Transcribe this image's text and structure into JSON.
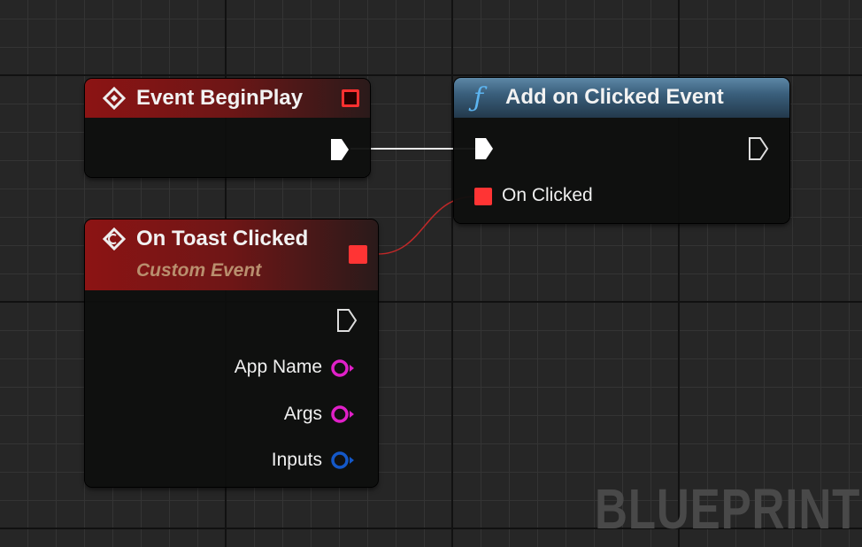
{
  "nodes": {
    "begin_play": {
      "title": "Event BeginPlay"
    },
    "add_clicked": {
      "title": "Add on Clicked Event",
      "pins": {
        "on_clicked": "On Clicked"
      }
    },
    "toast": {
      "title": "On Toast Clicked",
      "subtitle": "Custom Event",
      "pins": {
        "app_name": "App Name",
        "args": "Args",
        "inputs": "Inputs"
      }
    }
  },
  "watermark": "BLUEPRINT",
  "colors": {
    "event_header": "#8c1414",
    "function_header": "#3a5f7c",
    "delegate_pin": "#ff3838",
    "string_pin": "#e020c8",
    "struct_pin": "#1050c8",
    "exec_wire": "#ffffff",
    "delegate_wire": "#c82828"
  }
}
